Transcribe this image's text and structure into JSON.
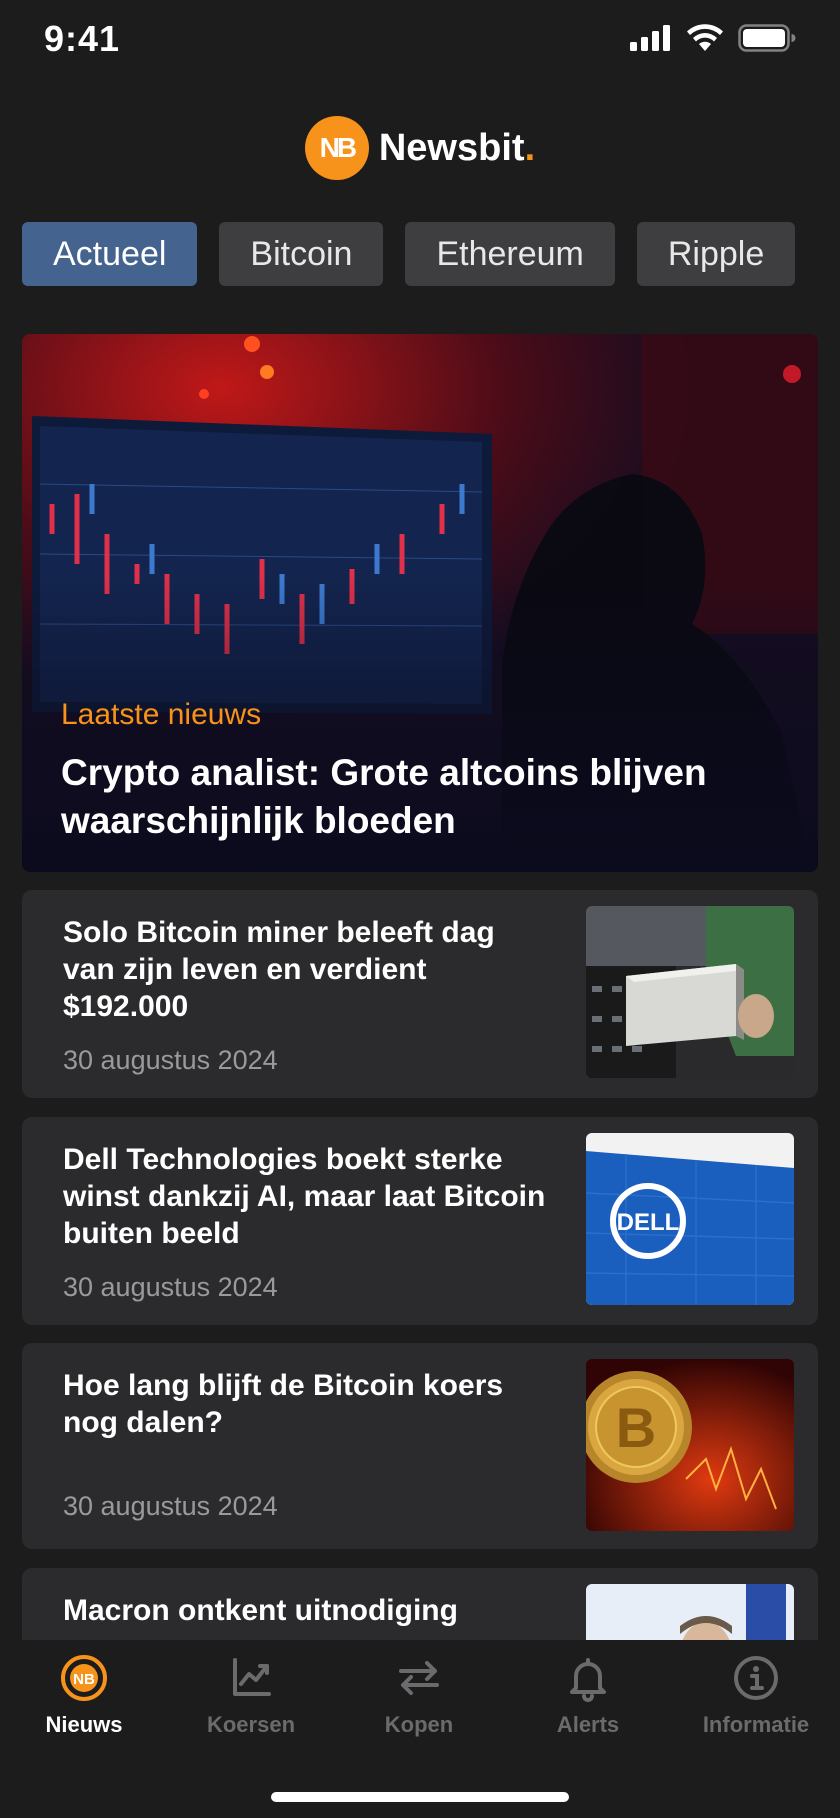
{
  "status_bar": {
    "time": "9:41"
  },
  "brand": {
    "name": "Newsbit",
    "dot": ".",
    "accent": "#f7931a"
  },
  "tabs": [
    {
      "label": "Actueel",
      "active": true
    },
    {
      "label": "Bitcoin",
      "active": false
    },
    {
      "label": "Ethereum",
      "active": false
    },
    {
      "label": "Ripple",
      "active": false
    }
  ],
  "hero": {
    "category": "Laatste nieuws",
    "title": "Crypto analist: Grote altcoins blijven waarschijnlijk bloeden"
  },
  "articles": [
    {
      "title": "Solo Bitcoin miner beleeft dag van zijn leven en verdient $192.000",
      "date": "30 augustus 2024",
      "image": "bitcoin-miner-photo"
    },
    {
      "title": "Dell Technologies boekt sterke winst dankzij AI, maar laat Bitcoin buiten beeld",
      "date": "30 augustus 2024",
      "image": "dell-building-photo"
    },
    {
      "title": "Hoe lang blijft de Bitcoin koers nog dalen?",
      "date": "30 augustus 2024",
      "image": "bitcoin-coin-photo"
    },
    {
      "title": "Macron ontkent uitnodiging",
      "date": "",
      "image": "macron-photo"
    }
  ],
  "bottom_nav": [
    {
      "label": "Nieuws",
      "icon": "newsbit-logo-icon",
      "active": true
    },
    {
      "label": "Koersen",
      "icon": "chart-icon",
      "active": false
    },
    {
      "label": "Kopen",
      "icon": "swap-arrows-icon",
      "active": false
    },
    {
      "label": "Alerts",
      "icon": "bell-icon",
      "active": false
    },
    {
      "label": "Informatie",
      "icon": "info-icon",
      "active": false
    }
  ],
  "colors": {
    "background": "#1c1c1d",
    "card": "#2b2b2d",
    "tab": "#3e3e40",
    "tab_active": "#45638f"
  }
}
